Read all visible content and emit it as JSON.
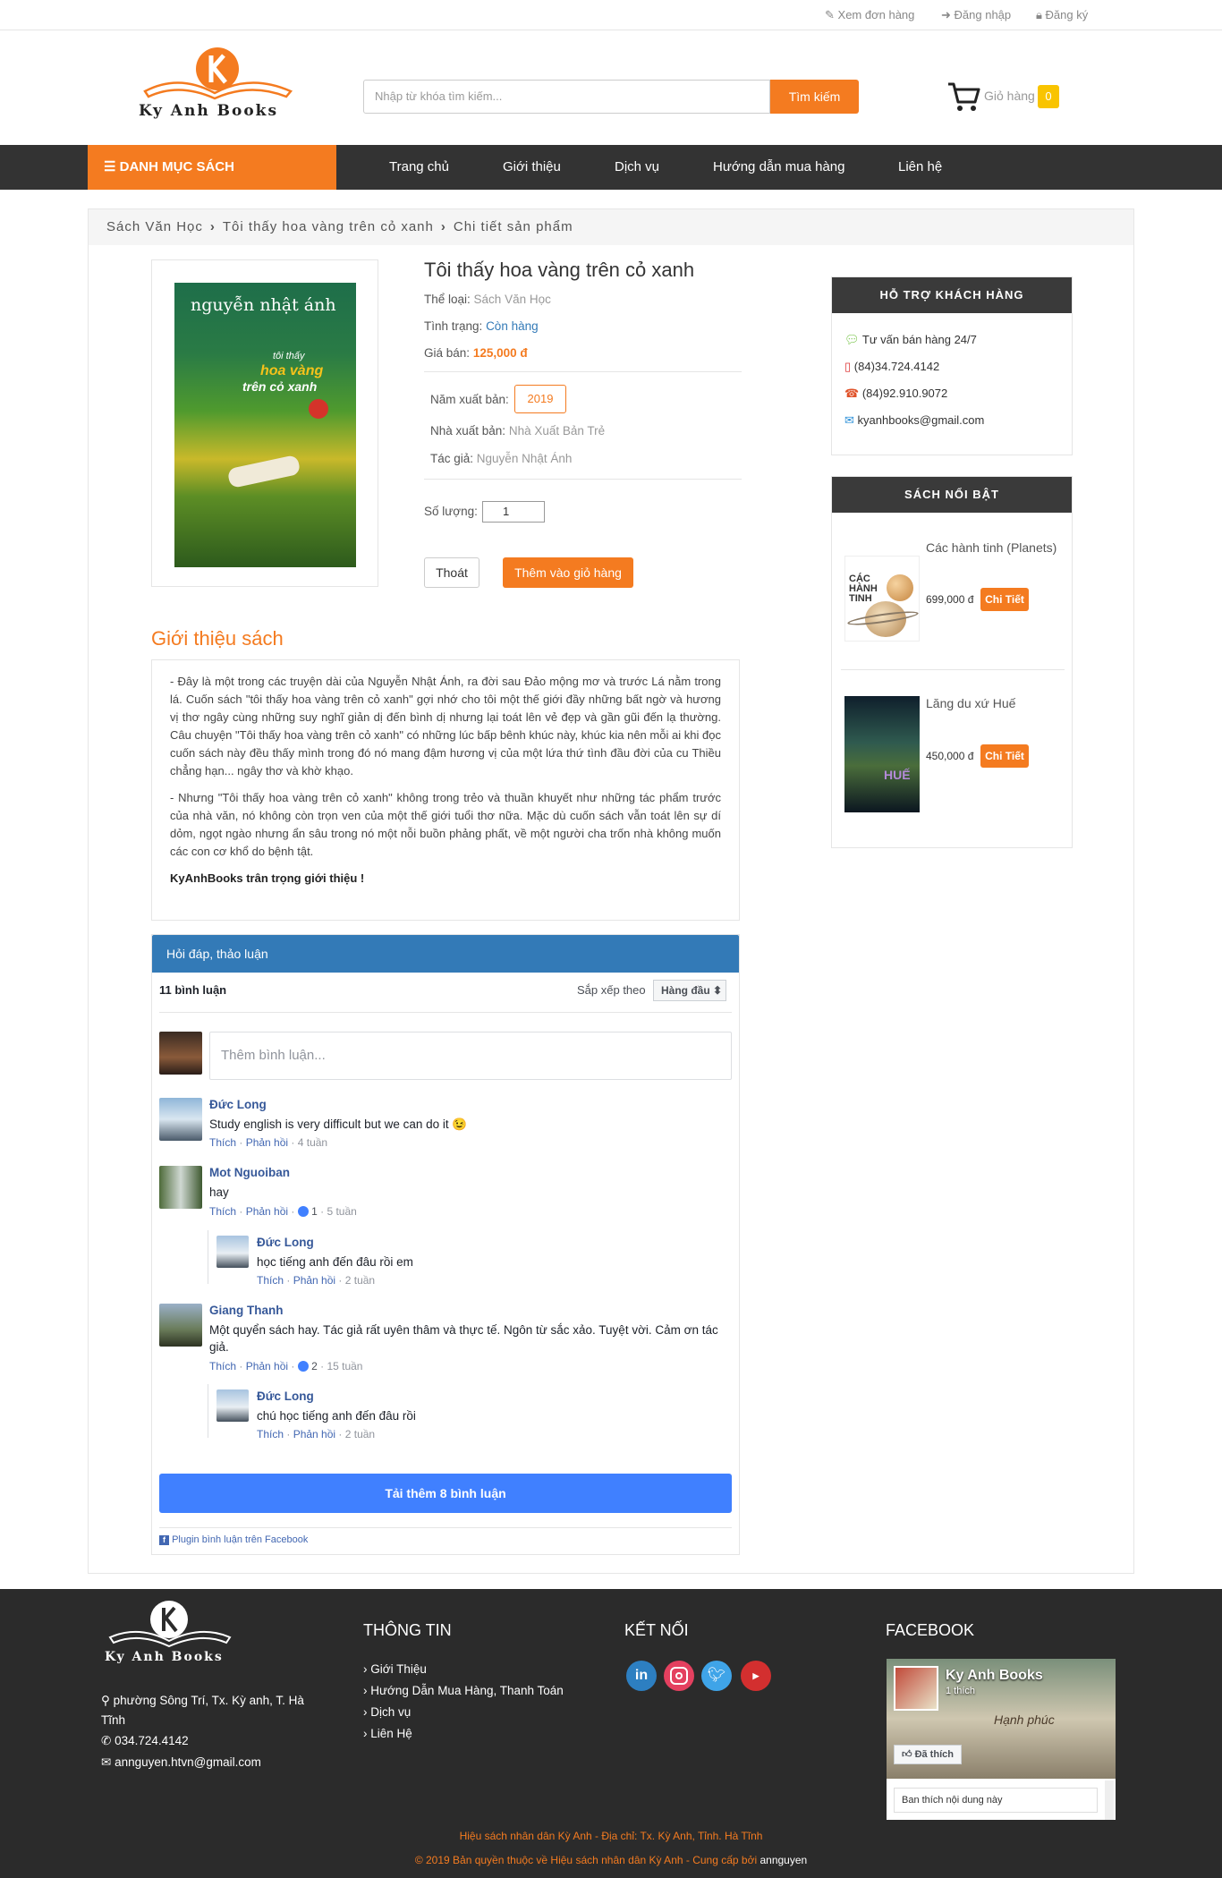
{
  "topbar": {
    "orders": "Xem đơn hàng",
    "login": "Đăng nhập",
    "register": "Đăng ký"
  },
  "header": {
    "logo_text": "Ky Anh Books",
    "search_placeholder": "Nhập từ khóa tìm kiếm...",
    "search_button": "Tìm kiếm",
    "cart_label": "Giỏ hàng",
    "cart_count": "0"
  },
  "nav": {
    "category": "DANH MỤC SÁCH",
    "items": [
      "Trang chủ",
      "Giới thiệu",
      "Dịch vụ",
      "Hướng dẫn mua hàng",
      "Liên hệ"
    ]
  },
  "breadcrumb": [
    "Sách Văn Học",
    "Tôi thấy hoa vàng trên cỏ xanh",
    "Chi tiết sản phẩm"
  ],
  "product": {
    "title": "Tôi thấy hoa vàng trên cỏ xanh",
    "category_label": "Thể loại:",
    "category": "Sách Văn Học",
    "status_label": "Tình trạng:",
    "status": "Còn hàng",
    "price_label": "Giá bán:",
    "price": "125,000 đ",
    "year_label": "Năm xuất bản:",
    "year": "2019",
    "publisher_label": "Nhà xuất bản:",
    "publisher": "Nhà Xuất Bản Trẻ",
    "author_label": "Tác giả:",
    "author": "Nguyễn Nhật Ánh",
    "qty_label": "Số lượng:",
    "qty": "1",
    "exit_button": "Thoát",
    "add_button": "Thêm vào giỏ hàng",
    "cover_author": "nguyễn nhật ánh",
    "cover_title_1": "tôi thấy",
    "cover_title_2": "hoa vàng",
    "cover_title_3": "trên cỏ xanh"
  },
  "intro": {
    "heading": "Giới thiệu sách",
    "p1": "- Đây là một trong các truyện dài của Nguyễn Nhật Ánh, ra đời sau Đảo mộng mơ và trước Lá nằm trong lá. Cuốn sách \"tôi thấy hoa vàng trên cỏ xanh\" gợi nhớ cho tôi một thế giới đầy những bất ngờ và hương vị thơ ngây cùng những suy nghĩ giản dị đến bình dị nhưng lại toát lên vẻ đẹp và gần gũi đến lạ thường. Câu chuyện \"Tôi thấy hoa vàng trên cỏ xanh\" có những lúc bấp bênh khúc này, khúc kia nên mỗi ai khi đọc cuốn sách này đều thấy mình trong đó nó mang đậm hương vị của một lứa thứ tình đầu đời của cu Thiều chẳng hạn... ngây thơ và khờ khạo.",
    "p2": "- Nhưng \"Tôi thấy hoa vàng trên cỏ xanh\" không trong trẻo và thuần khuyết như những tác phẩm trước của nhà văn, nó không còn trọn ven của một thế giới tuổi thơ nữa. Mặc dù cuốn sách vẫn toát lên sự dí dỏm, ngọt ngào nhưng ẩn sâu trong nó một nỗi buồn phảng phất, về một người cha trốn nhà không muốn các con cơ khổ do bệnh tật.",
    "p3": "KyAnhBooks trân trọng giới thiệu !"
  },
  "comments": {
    "header": "Hỏi đáp, thảo luận",
    "count": "11 bình luận",
    "sort_label": "Sắp xếp theo",
    "sort_value": "Hàng đầu",
    "add_placeholder": "Thêm bình luận...",
    "like": "Thích",
    "reply": "Phản hồi",
    "items": [
      {
        "name": "Đức Long",
        "text": "Study english is very difficult but we can do it 😉",
        "time": "4 tuần",
        "likes": ""
      },
      {
        "name": "Mot Nguoiban",
        "text": "hay",
        "time": "5 tuần",
        "likes": "1"
      },
      {
        "name": "Đức Long",
        "text": "học tiếng anh đến đâu rồi em",
        "time": "2 tuần",
        "likes": ""
      },
      {
        "name": "Giang Thanh",
        "text": "Một quyển sách hay. Tác giả rất uyên thâm và thực tế. Ngôn từ sắc xảo. Tuyệt vời. Cảm ơn tác giả.",
        "time": "15 tuần",
        "likes": "2"
      },
      {
        "name": "Đức Long",
        "text": "chú học tiếng anh đến đâu rồi",
        "time": "2 tuần",
        "likes": ""
      }
    ],
    "load_more": "Tải thêm 8 bình luận",
    "plugin": "Plugin bình luận trên Facebook"
  },
  "sidebar": {
    "support_title": "HỖ TRỢ KHÁCH HÀNG",
    "support_items": [
      "Tư vấn bán hàng 24/7",
      "(84)34.724.4142",
      "(84)92.910.9072",
      "kyanhbooks@gmail.com"
    ],
    "featured_title": "SÁCH NỔI BẬT",
    "featured": [
      {
        "title": "Các hành tinh (Planets)",
        "price": "699,000 đ",
        "button": "Chi Tiết",
        "cover_text": "CÁC HÀNH TINH"
      },
      {
        "title": "Lăng du xứ Huế",
        "price": "450,000 đ",
        "button": "Chi Tiết",
        "cover_text": "HUẾ"
      }
    ]
  },
  "footer": {
    "logo_text": "Ky Anh Books",
    "address": "phường Sông Trí, Tx. Kỳ anh, T. Hà Tĩnh",
    "phone": "034.724.4142",
    "email": "annguyen.htvn@gmail.com",
    "info_title": "THÔNG TIN",
    "info_items": [
      "Giới Thiệu",
      "Hướng Dẫn Mua Hàng, Thanh Toán",
      "Dịch vụ",
      "Liên Hệ"
    ],
    "connect_title": "KẾT NỐI",
    "facebook_title": "FACEBOOK",
    "fb_page_name": "Ky Anh Books",
    "fb_likes": "1 thích",
    "fb_liked": "Đã thích",
    "fb_placeholder": "Ban thích nội dung này",
    "copy1": "Hiệu sách nhân dân Kỳ Anh - Địa chỉ: Tx. Kỳ Anh, Tỉnh. Hà Tĩnh",
    "copy2": "© 2019 Bản quyền thuộc về Hiệu sách nhân dân Kỳ Anh - Cung cấp bởi",
    "copy2_author": "annguyen"
  },
  "colors": {
    "accent": "#f47b20",
    "nav": "#333333",
    "fb_blue": "#4080ff",
    "comment_header": "#337ab7"
  }
}
